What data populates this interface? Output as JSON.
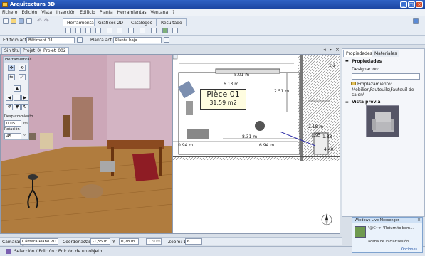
{
  "window": {
    "title": "Arquitectura 3D",
    "buttons": [
      "_",
      "□",
      "×"
    ]
  },
  "menu": [
    "Fichero",
    "Edición",
    "Vista",
    "Inserción",
    "Edificio",
    "Planta",
    "Herramientas",
    "Ventana",
    "?"
  ],
  "ribbon_tabs": [
    "Herramientas",
    "Gráficos 2D",
    "Catálogos",
    "Resultado"
  ],
  "building": {
    "label": "Edificio actual:",
    "value": "Bâtiment 01"
  },
  "floor": {
    "label": "Planta actual:",
    "value": "Planta baja"
  },
  "doc_tabs": [
    "Sin título",
    "Projet_001",
    "Projet_002"
  ],
  "tools_panel": {
    "title": "Herramientas",
    "displacement": {
      "label": "Desplazamiento",
      "value": "0.05",
      "unit": "m"
    },
    "rotation": {
      "label": "Rotación",
      "value": "45",
      "unit": "°"
    }
  },
  "plan": {
    "room_name": "Pièce 01",
    "room_area": "31.59 m2",
    "dimensions": [
      "5.01 m",
      "6.13 m",
      "2.51 m",
      "8.31 m",
      "6.94 m",
      "2.18 m",
      "1.95",
      "1.88",
      "0.94 m",
      "4.40",
      "1.2"
    ]
  },
  "props_panel": {
    "tabs": [
      "Propiedades",
      "Materiales"
    ],
    "section": "Propiedades",
    "designation_label": "Designación:",
    "location_label": "Emplazamiento:",
    "location_value": "Mobilier\\Fauteuils\\Fauteuil de salon\\",
    "preview_title": "Vista previa"
  },
  "messenger": {
    "title": "Windows Live Messenger",
    "line1": "\"@C~> \"Return to born...",
    "line2": "acaba de iniciar sesión.",
    "options": "Opciones"
  },
  "bottombar": {
    "camera_label": "Cámaras:",
    "camera_value": "Cámara Plano 2D 1",
    "coords_label": "Coordenadas",
    "x_label": "X :",
    "x_value": "-1,55 m",
    "y_label": "Y :",
    "y_value": "0,78 m",
    "z_value": "1.50m",
    "zoom_label": "Zoom: 1 /",
    "zoom_value": "61"
  },
  "status": {
    "text": "Selección / Edición : Edición de un objeto"
  }
}
